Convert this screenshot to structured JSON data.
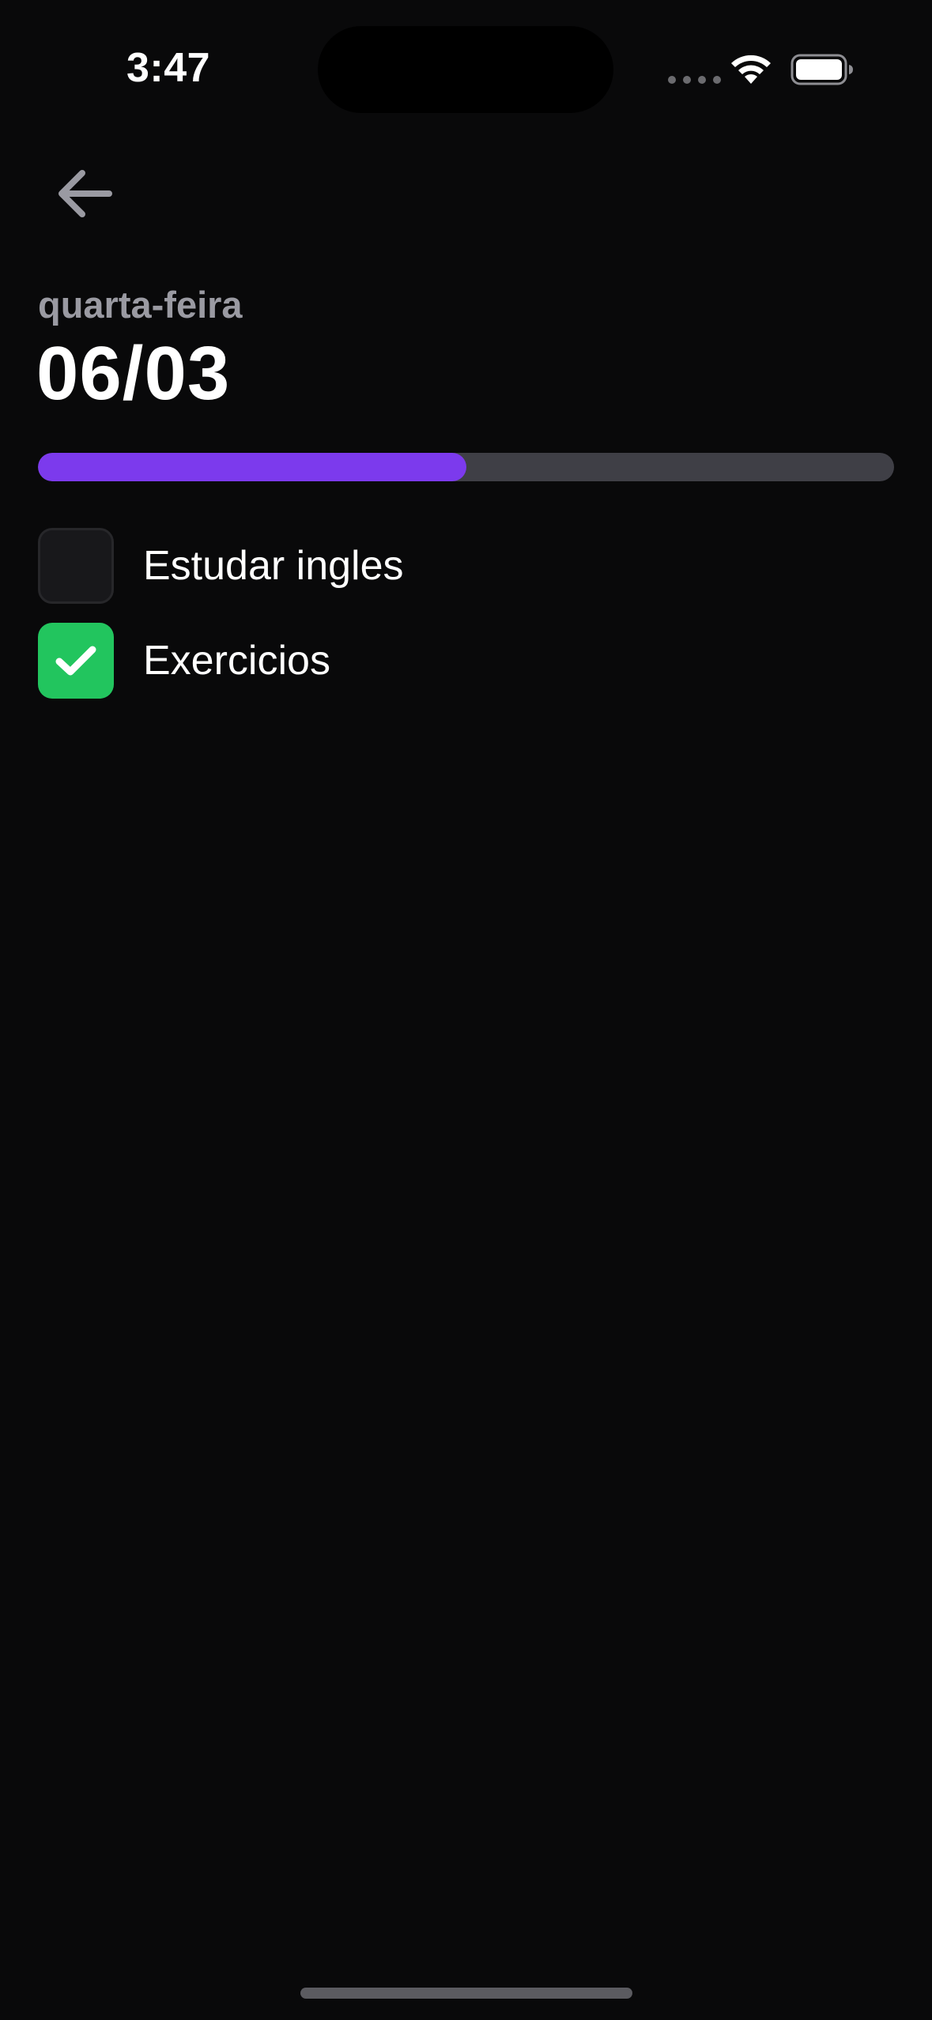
{
  "status_bar": {
    "time": "3:47",
    "icons": [
      "cellular-signal-icon",
      "wifi-icon",
      "battery-icon"
    ]
  },
  "header": {
    "back_icon": "arrow-left-icon",
    "weekday": "quarta-feira",
    "date": "06/03"
  },
  "progress": {
    "completed": 1,
    "total": 2,
    "percent": 50
  },
  "habits": [
    {
      "label": "Estudar ingles",
      "checked": false
    },
    {
      "label": "Exercicios",
      "checked": true
    }
  ],
  "colors": {
    "background": "#09090a",
    "progress_fill": "#7c3aed",
    "progress_track": "#3f3f46",
    "checked": "#22c55e",
    "unchecked": "#18181b",
    "weekday_text": "#9a9aa2"
  }
}
